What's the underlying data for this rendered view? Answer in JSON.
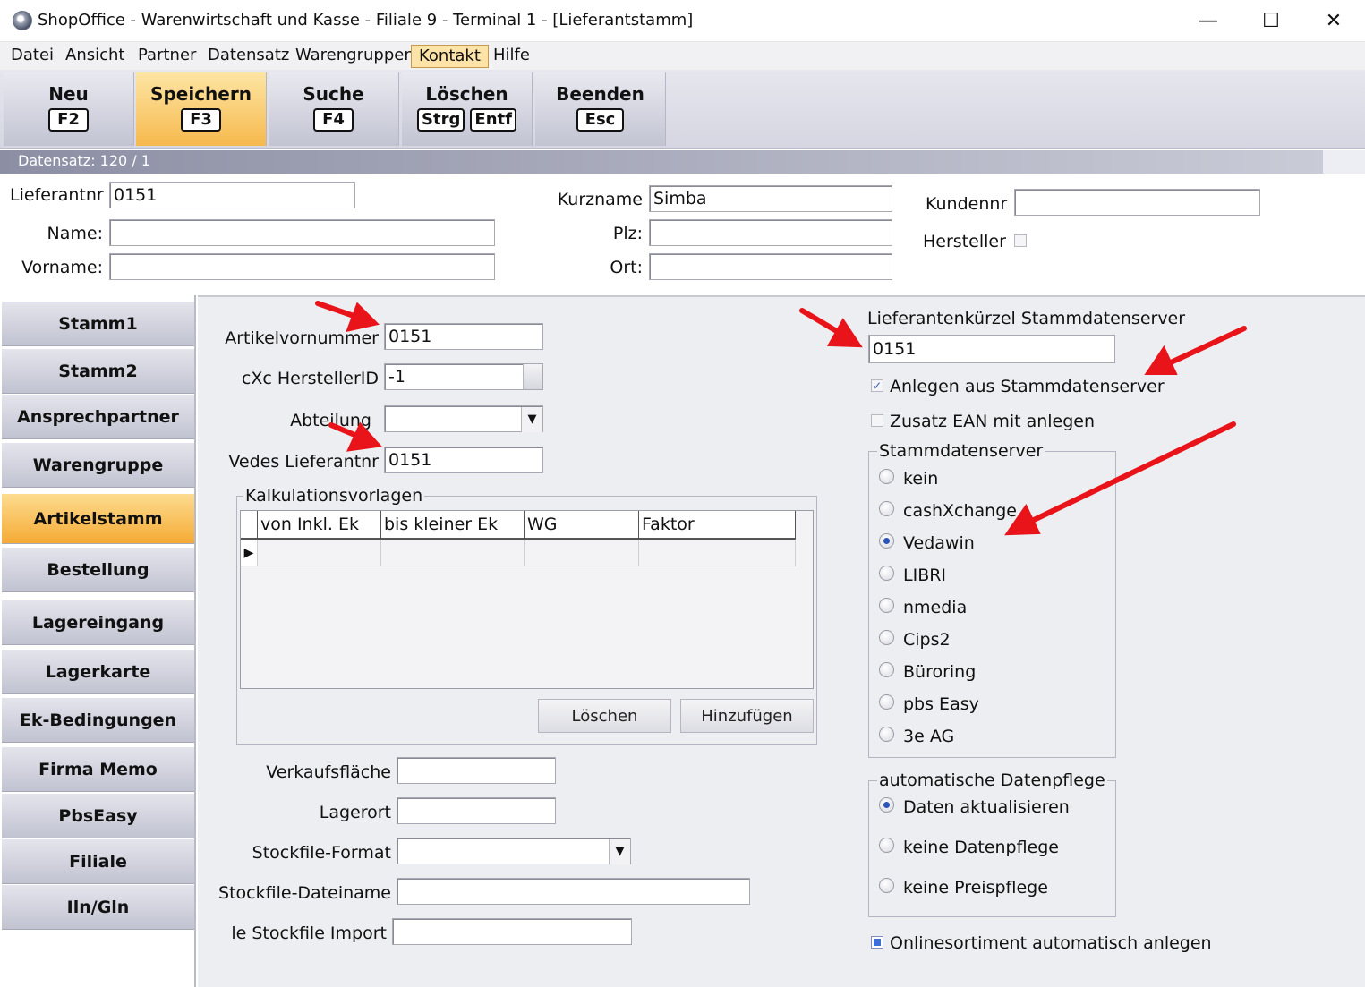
{
  "window": {
    "title": "ShopOffice - Warenwirtschaft und Kasse - Filiale 9 - Terminal 1 - [Lieferantstamm]",
    "minimize": "—",
    "maximize": "☐",
    "close": "✕"
  },
  "menu": [
    "Datei",
    "Ansicht",
    "Partner",
    "Datensatz",
    "Warengruppen",
    "Kontakt",
    "Hilfe"
  ],
  "toolbar": [
    {
      "label": "Neu",
      "keys": [
        "F2"
      ]
    },
    {
      "label": "Speichern",
      "keys": [
        "F3"
      ]
    },
    {
      "label": "Suche",
      "keys": [
        "F4"
      ]
    },
    {
      "label": "Löschen",
      "keys": [
        "Strg",
        "Entf"
      ]
    },
    {
      "label": "Beenden",
      "keys": [
        "Esc"
      ]
    }
  ],
  "record": "Datensatz: 120 / 1",
  "header": {
    "lieferantnr_label": "Lieferantnr",
    "lieferantnr_value": "0151",
    "name_label": "Name:",
    "name_value": "",
    "vorname_label": "Vorname:",
    "vorname_value": "",
    "kurzname_label": "Kurzname",
    "kurzname_value": "Simba",
    "plz_label": "Plz:",
    "plz_value": "",
    "ort_label": "Ort:",
    "ort_value": "",
    "kundennr_label": "Kundennr",
    "kundennr_value": "",
    "hersteller_label": "Hersteller"
  },
  "nav": [
    "Stamm1",
    "Stamm2",
    "Ansprechpartner",
    "Warengruppe",
    "Artikelstamm",
    "Bestellung",
    "Lagereingang",
    "Lagerkarte",
    "Ek-Bedingungen",
    "Firma Memo",
    "PbsEasy",
    "Filiale",
    "Iln/Gln"
  ],
  "artikel": {
    "artikelvornummer_label": "Artikelvornummer",
    "artikelvornummer_value": "0151",
    "herstellerid_label": "cXc HerstellerID",
    "herstellerid_value": "-1",
    "abteilung_label": "Abteilung",
    "abteilung_value": "",
    "vedes_label": "Vedes Lieferantnr",
    "vedes_value": "0151"
  },
  "kalkulation": {
    "title": "Kalkulationsvorlagen",
    "columns": [
      "von Inkl. Ek",
      "bis kleiner Ek",
      "WG",
      "Faktor"
    ],
    "delete_button": "Löschen",
    "add_button": "Hinzufügen"
  },
  "lower": {
    "verkaufsflaeche_label": "Verkaufsfläche",
    "verkaufsflaeche_value": "",
    "lagerort_label": "Lagerort",
    "lagerort_value": "",
    "stockfile_format_label": "Stockfile-Format",
    "stockfile_format_value": "",
    "stockfile_dateiname_label": "Stockfile-Dateiname",
    "stockfile_dateiname_value": "",
    "stockfile_import_label": "le Stockfile Import",
    "stockfile_import_value": ""
  },
  "stammdaten": {
    "kuerzel_label": "Lieferantenkürzel Stammdatenserver",
    "kuerzel_value": "0151",
    "anlegen_label": "Anlegen aus Stammdatenserver",
    "anlegen_checked": "✓",
    "zusatz_label": "Zusatz EAN mit anlegen",
    "server_title": "Stammdatenserver",
    "servers": [
      "kein",
      "cashXchange",
      "Vedawin",
      "LIBRI",
      "nmedia",
      "Cips2",
      "Büroring",
      "pbs Easy",
      "3e AG"
    ],
    "server_selected": "Vedawin",
    "pflege_title": "automatische Datenpflege",
    "pflege": [
      "Daten aktualisieren",
      "keine Datenpflege",
      "keine Preispflege"
    ],
    "pflege_selected": "Daten aktualisieren",
    "online_label": "Onlinesortiment automatisch anlegen"
  },
  "colors": {
    "accent": "#f6b94d",
    "annotation_arrow": "#e8141a",
    "radio_dot": "#2a55b8"
  }
}
